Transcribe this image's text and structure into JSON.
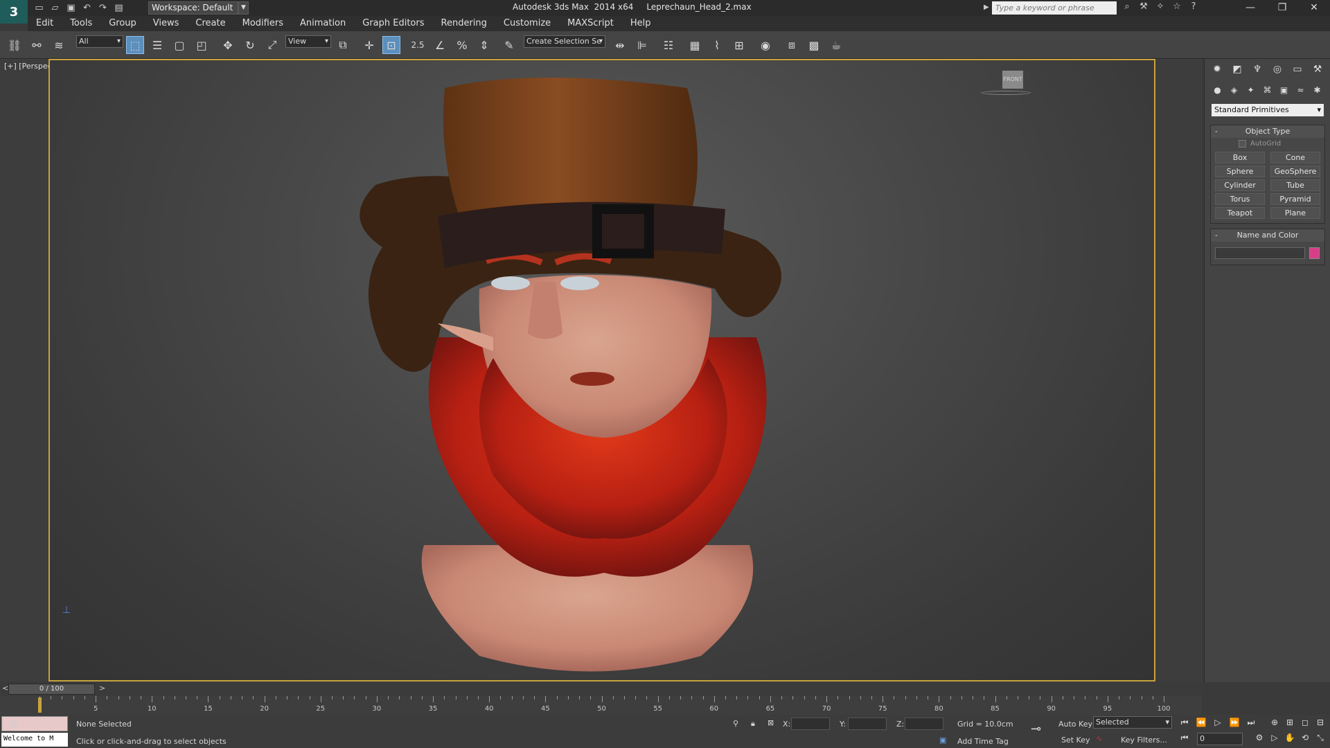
{
  "app": {
    "logo": "3",
    "title": "Autodesk 3ds Max  2014 x64     Leprechaun_Head_2.max"
  },
  "workspace": {
    "label": "Workspace: Default"
  },
  "search": {
    "placeholder": "Type a keyword or phrase"
  },
  "menu": [
    "Edit",
    "Tools",
    "Group",
    "Views",
    "Create",
    "Modifiers",
    "Animation",
    "Graph Editors",
    "Rendering",
    "Customize",
    "MAXScript",
    "Help"
  ],
  "toolbar": {
    "filter": "All",
    "coord_system": "View",
    "snap_value": "2.5",
    "selection_set": "Create Selection Se"
  },
  "viewport": {
    "label": "[+] [Perspective ] [Shaded ]",
    "viewcube": "FRONT"
  },
  "command_panel": {
    "category": "Standard Primitives",
    "object_type_title": "Object Type",
    "autogrid": "AutoGrid",
    "primitives": [
      "Box",
      "Cone",
      "Sphere",
      "GeoSphere",
      "Cylinder",
      "Tube",
      "Torus",
      "Pyramid",
      "Teapot",
      "Plane"
    ],
    "name_color_title": "Name and Color",
    "object_color": "#d83e87"
  },
  "timeline": {
    "frame_label": "0 / 100",
    "ticks": [
      5,
      10,
      15,
      20,
      25,
      30,
      35,
      40,
      45,
      50,
      55,
      60,
      65,
      70,
      75,
      80,
      85,
      90,
      95,
      100
    ]
  },
  "status": {
    "welcome": "Welcome to M",
    "selection": "None Selected",
    "prompt": "Click or click-and-drag to select objects",
    "x": "X:",
    "y": "Y:",
    "z": "Z:",
    "grid": "Grid = 10.0cm",
    "add_time_tag": "Add Time Tag",
    "auto_key": "Auto Key",
    "set_key": "Set Key",
    "selected": "Selected",
    "key_filters": "Key Filters...",
    "frame": "0"
  }
}
